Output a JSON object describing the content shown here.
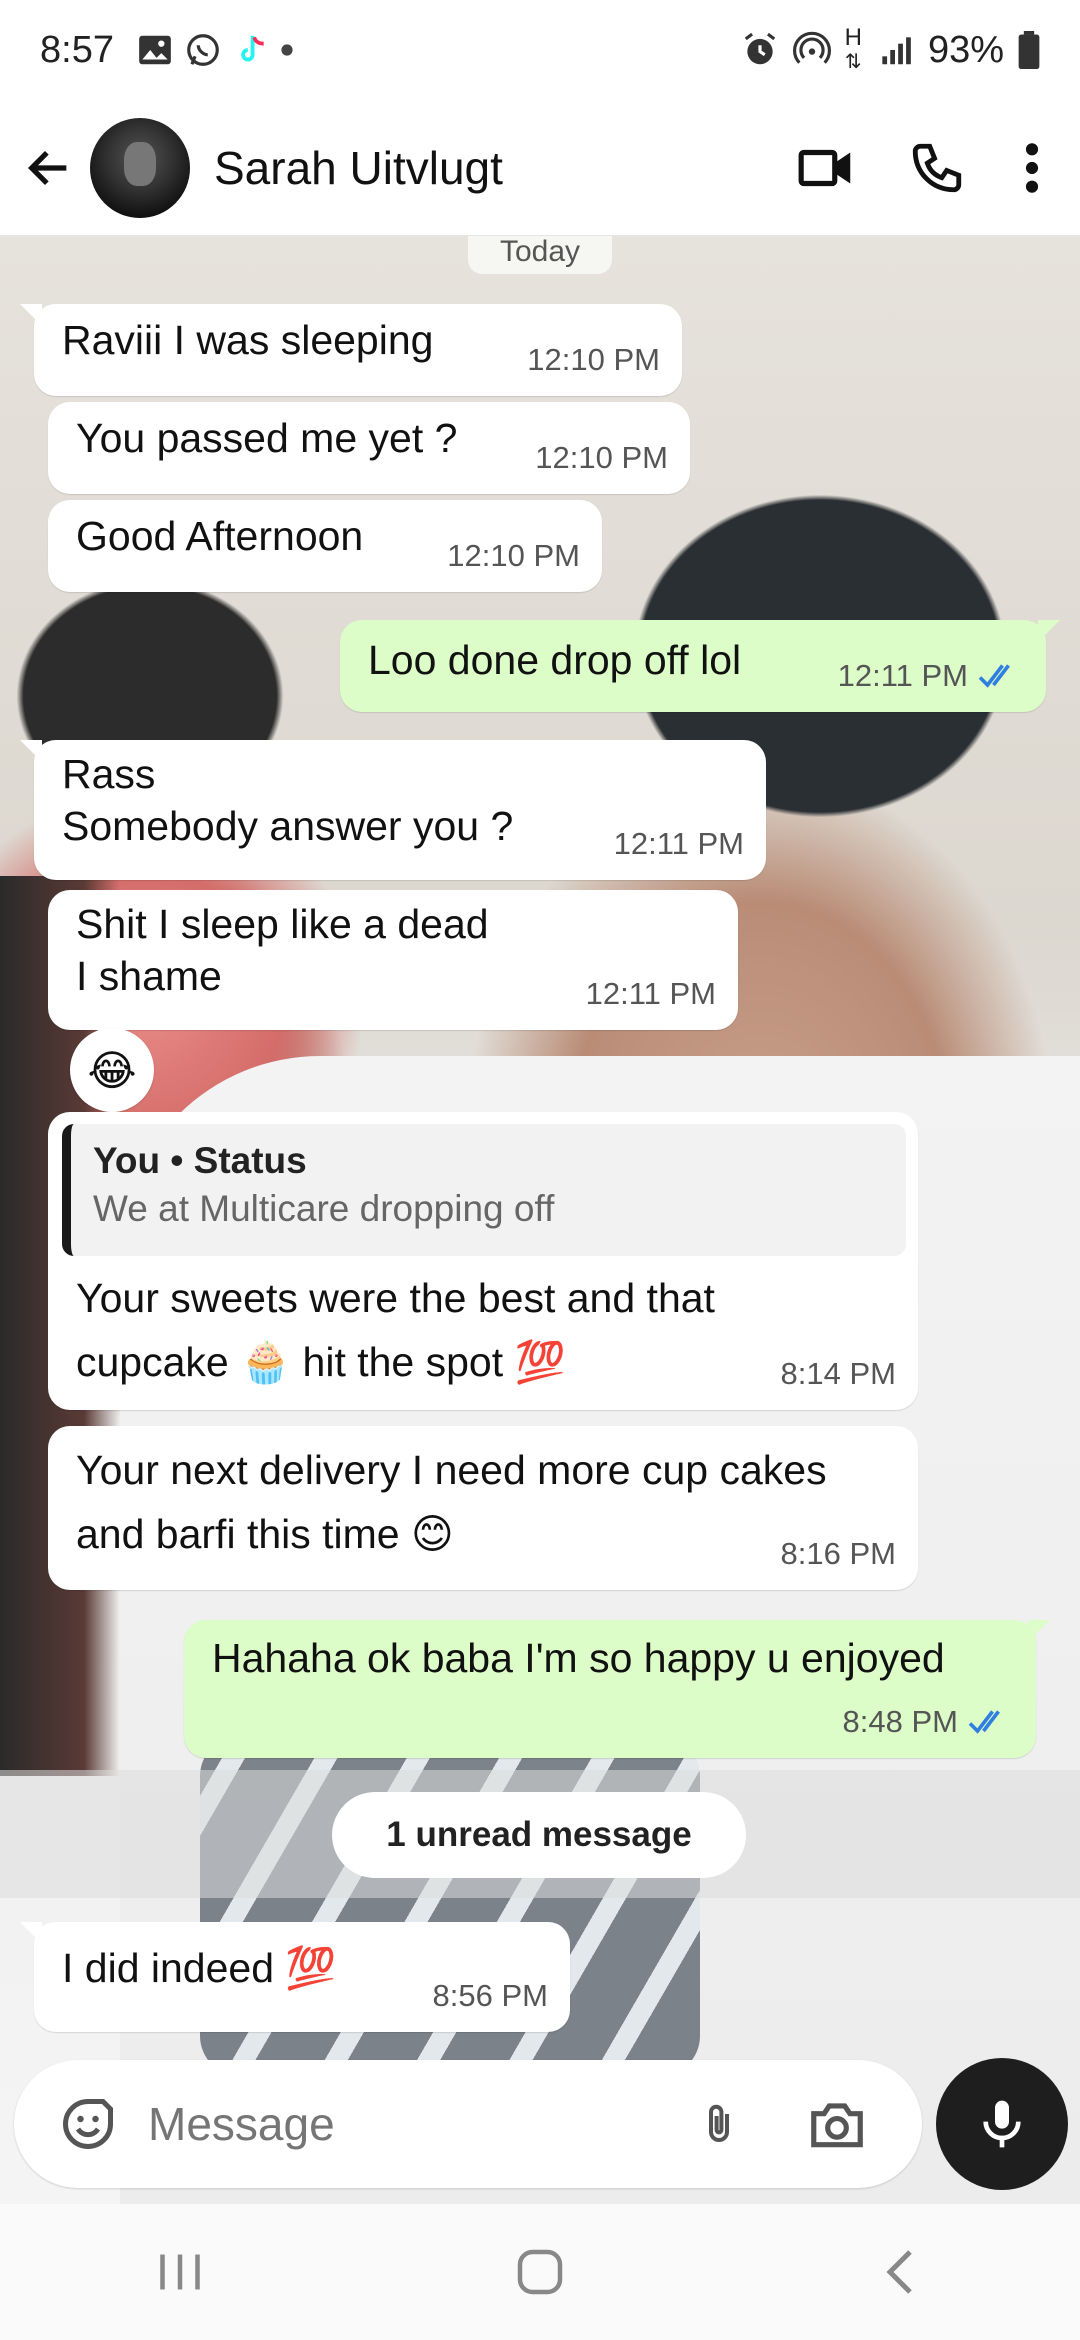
{
  "status_bar": {
    "time": "8:57",
    "battery": "93%",
    "network_label": "H"
  },
  "header": {
    "contact_name": "Sarah Uitvlugt"
  },
  "chat": {
    "date_chip": "Today",
    "messages": [
      {
        "text": "Raviii I was sleeping",
        "time": "12:10 PM"
      },
      {
        "text": "You passed me yet ?",
        "time": "12:10 PM"
      },
      {
        "text": "Good Afternoon",
        "time": "12:10 PM"
      },
      {
        "text": "Loo done drop off lol",
        "time": "12:11 PM"
      },
      {
        "text": "Rass\nSomebody answer you ?",
        "time": "12:11 PM"
      },
      {
        "text": "Shit I sleep like a dead\nI shame",
        "time": "12:11 PM"
      },
      {
        "quote_title": "You • Status",
        "quote_text": "We at Multicare dropping off",
        "text": "Your sweets were the best and that\ncupcake 🧁 hit the spot 💯",
        "time": "8:14 PM"
      },
      {
        "text": "Your next delivery I need more cup cakes\nand barfi this time 😊",
        "time": "8:16 PM"
      },
      {
        "text": "Hahaha ok baba I'm so happy u enjoyed",
        "time": "8:48 PM"
      },
      {
        "text": "I did indeed 💯",
        "time": "8:56 PM"
      }
    ],
    "reaction": "😂",
    "unread_label": "1 unread message"
  },
  "composer": {
    "placeholder": "Message"
  },
  "colors": {
    "outgoing_bubble": "#dcfcc8",
    "read_ticks": "#2f7fe0"
  }
}
